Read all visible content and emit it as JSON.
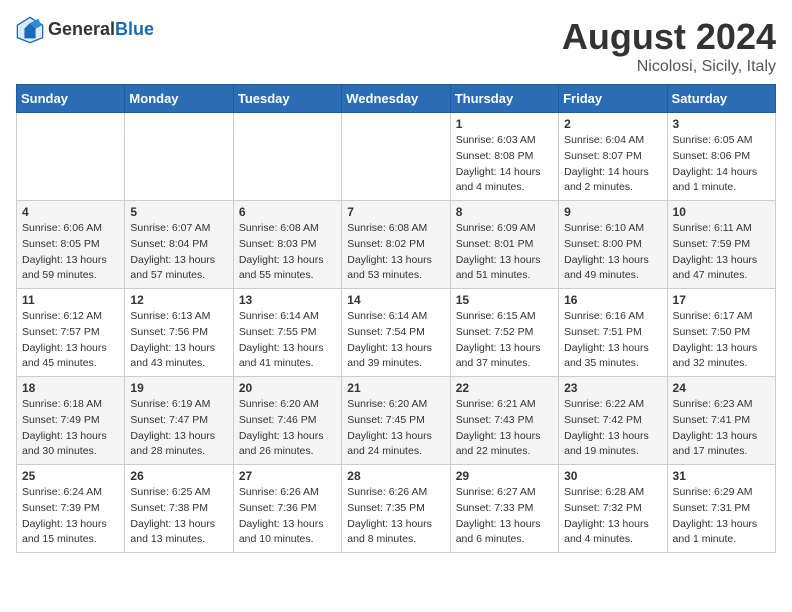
{
  "header": {
    "logo_general": "General",
    "logo_blue": "Blue",
    "title": "August 2024",
    "location": "Nicolosi, Sicily, Italy"
  },
  "calendar": {
    "days_of_week": [
      "Sunday",
      "Monday",
      "Tuesday",
      "Wednesday",
      "Thursday",
      "Friday",
      "Saturday"
    ],
    "weeks": [
      [
        {
          "day": "",
          "info": ""
        },
        {
          "day": "",
          "info": ""
        },
        {
          "day": "",
          "info": ""
        },
        {
          "day": "",
          "info": ""
        },
        {
          "day": "1",
          "info": "Sunrise: 6:03 AM\nSunset: 8:08 PM\nDaylight: 14 hours and 4 minutes."
        },
        {
          "day": "2",
          "info": "Sunrise: 6:04 AM\nSunset: 8:07 PM\nDaylight: 14 hours and 2 minutes."
        },
        {
          "day": "3",
          "info": "Sunrise: 6:05 AM\nSunset: 8:06 PM\nDaylight: 14 hours and 1 minute."
        }
      ],
      [
        {
          "day": "4",
          "info": "Sunrise: 6:06 AM\nSunset: 8:05 PM\nDaylight: 13 hours and 59 minutes."
        },
        {
          "day": "5",
          "info": "Sunrise: 6:07 AM\nSunset: 8:04 PM\nDaylight: 13 hours and 57 minutes."
        },
        {
          "day": "6",
          "info": "Sunrise: 6:08 AM\nSunset: 8:03 PM\nDaylight: 13 hours and 55 minutes."
        },
        {
          "day": "7",
          "info": "Sunrise: 6:08 AM\nSunset: 8:02 PM\nDaylight: 13 hours and 53 minutes."
        },
        {
          "day": "8",
          "info": "Sunrise: 6:09 AM\nSunset: 8:01 PM\nDaylight: 13 hours and 51 minutes."
        },
        {
          "day": "9",
          "info": "Sunrise: 6:10 AM\nSunset: 8:00 PM\nDaylight: 13 hours and 49 minutes."
        },
        {
          "day": "10",
          "info": "Sunrise: 6:11 AM\nSunset: 7:59 PM\nDaylight: 13 hours and 47 minutes."
        }
      ],
      [
        {
          "day": "11",
          "info": "Sunrise: 6:12 AM\nSunset: 7:57 PM\nDaylight: 13 hours and 45 minutes."
        },
        {
          "day": "12",
          "info": "Sunrise: 6:13 AM\nSunset: 7:56 PM\nDaylight: 13 hours and 43 minutes."
        },
        {
          "day": "13",
          "info": "Sunrise: 6:14 AM\nSunset: 7:55 PM\nDaylight: 13 hours and 41 minutes."
        },
        {
          "day": "14",
          "info": "Sunrise: 6:14 AM\nSunset: 7:54 PM\nDaylight: 13 hours and 39 minutes."
        },
        {
          "day": "15",
          "info": "Sunrise: 6:15 AM\nSunset: 7:52 PM\nDaylight: 13 hours and 37 minutes."
        },
        {
          "day": "16",
          "info": "Sunrise: 6:16 AM\nSunset: 7:51 PM\nDaylight: 13 hours and 35 minutes."
        },
        {
          "day": "17",
          "info": "Sunrise: 6:17 AM\nSunset: 7:50 PM\nDaylight: 13 hours and 32 minutes."
        }
      ],
      [
        {
          "day": "18",
          "info": "Sunrise: 6:18 AM\nSunset: 7:49 PM\nDaylight: 13 hours and 30 minutes."
        },
        {
          "day": "19",
          "info": "Sunrise: 6:19 AM\nSunset: 7:47 PM\nDaylight: 13 hours and 28 minutes."
        },
        {
          "day": "20",
          "info": "Sunrise: 6:20 AM\nSunset: 7:46 PM\nDaylight: 13 hours and 26 minutes."
        },
        {
          "day": "21",
          "info": "Sunrise: 6:20 AM\nSunset: 7:45 PM\nDaylight: 13 hours and 24 minutes."
        },
        {
          "day": "22",
          "info": "Sunrise: 6:21 AM\nSunset: 7:43 PM\nDaylight: 13 hours and 22 minutes."
        },
        {
          "day": "23",
          "info": "Sunrise: 6:22 AM\nSunset: 7:42 PM\nDaylight: 13 hours and 19 minutes."
        },
        {
          "day": "24",
          "info": "Sunrise: 6:23 AM\nSunset: 7:41 PM\nDaylight: 13 hours and 17 minutes."
        }
      ],
      [
        {
          "day": "25",
          "info": "Sunrise: 6:24 AM\nSunset: 7:39 PM\nDaylight: 13 hours and 15 minutes."
        },
        {
          "day": "26",
          "info": "Sunrise: 6:25 AM\nSunset: 7:38 PM\nDaylight: 13 hours and 13 minutes."
        },
        {
          "day": "27",
          "info": "Sunrise: 6:26 AM\nSunset: 7:36 PM\nDaylight: 13 hours and 10 minutes."
        },
        {
          "day": "28",
          "info": "Sunrise: 6:26 AM\nSunset: 7:35 PM\nDaylight: 13 hours and 8 minutes."
        },
        {
          "day": "29",
          "info": "Sunrise: 6:27 AM\nSunset: 7:33 PM\nDaylight: 13 hours and 6 minutes."
        },
        {
          "day": "30",
          "info": "Sunrise: 6:28 AM\nSunset: 7:32 PM\nDaylight: 13 hours and 4 minutes."
        },
        {
          "day": "31",
          "info": "Sunrise: 6:29 AM\nSunset: 7:31 PM\nDaylight: 13 hours and 1 minute."
        }
      ]
    ]
  }
}
